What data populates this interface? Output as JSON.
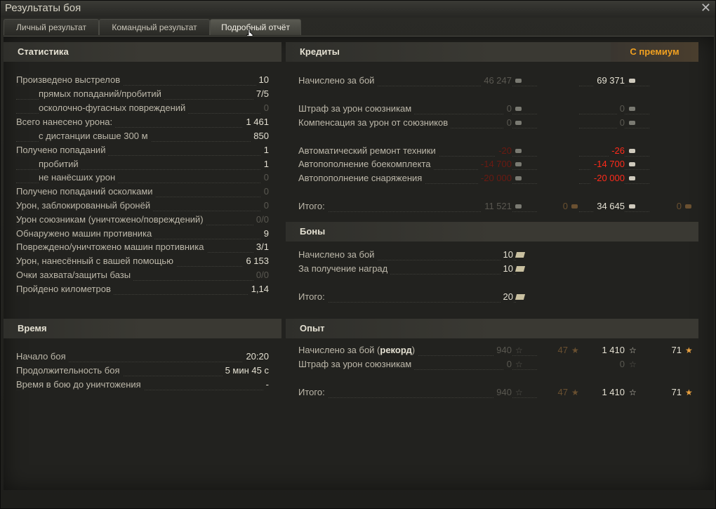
{
  "window": {
    "title": "Результаты боя"
  },
  "tabs": [
    {
      "label": "Личный результат"
    },
    {
      "label": "Командный результат"
    },
    {
      "label": "Подробный отчёт"
    }
  ],
  "statistics": {
    "header": "Статистика",
    "rows": [
      {
        "label": "Произведено выстрелов",
        "value": "10"
      },
      {
        "label": "прямых попаданий/пробитий",
        "value": "7/5"
      },
      {
        "label": "осколочно-фугасных повреждений",
        "value": "0"
      },
      {
        "label": "Всего нанесено урона:",
        "value": "1 461"
      },
      {
        "label": "с дистанции свыше 300 м",
        "value": "850"
      },
      {
        "label": "Получено попаданий",
        "value": "1"
      },
      {
        "label": "пробитий",
        "value": "1"
      },
      {
        "label": "не нанёсших урон",
        "value": "0"
      },
      {
        "label": "Получено попаданий осколками",
        "value": "0"
      },
      {
        "label": "Урон, заблокированный бронёй",
        "value": "0"
      },
      {
        "label": "Урон союзникам (уничтожено/повреждений)",
        "value": "0/0"
      },
      {
        "label": "Обнаружено машин противника",
        "value": "9"
      },
      {
        "label": "Повреждено/уничтожено машин противника",
        "value": "3/1"
      },
      {
        "label": "Урон, нанесённый с вашей помощью",
        "value": "6 153"
      },
      {
        "label": "Очки захвата/защиты базы",
        "value": "0/0"
      },
      {
        "label": "Пройдено километров",
        "value": "1,14"
      }
    ]
  },
  "time": {
    "header": "Время",
    "rows": [
      {
        "label": "Начало боя",
        "value": "20:20"
      },
      {
        "label": "Продолжительность боя",
        "value": "5 мин 45 с"
      },
      {
        "label": "Время в бою до уничтожения",
        "value": "-"
      }
    ]
  },
  "credits": {
    "header": "Кредиты",
    "premium_label": "С премиум",
    "rows": [
      {
        "label": "Начислено за бой",
        "base": "46 247",
        "prem": "69 371"
      },
      {
        "label": "Штраф за урон союзникам",
        "base": "0",
        "prem": "0"
      },
      {
        "label": "Компенсация за урон от союзников",
        "base": "0",
        "prem": "0"
      },
      {
        "label": "Автоматический ремонт техники",
        "base": "-20",
        "prem": "-26"
      },
      {
        "label": "Автопополнение боекомплекта",
        "base": "-14 700",
        "prem": "-14 700"
      },
      {
        "label": "Автопополнение снаряжения",
        "base": "-20 000",
        "prem": "-20 000"
      },
      {
        "label": "Итого:",
        "base": "11 521",
        "base_gold": "0",
        "prem": "34 645",
        "prem_gold": "0"
      }
    ]
  },
  "bonds": {
    "header": "Боны",
    "rows": [
      {
        "label": "Начислено за бой",
        "value": "10"
      },
      {
        "label": "За получение наград",
        "value": "10"
      },
      {
        "label": "Итого:",
        "value": "20"
      }
    ]
  },
  "experience": {
    "header": "Опыт",
    "rows": [
      {
        "label": "Начислено за бой (",
        "label_bold": "рекорд",
        "label_end": ")",
        "base": "940",
        "base_free": "47",
        "prem": "1 410",
        "prem_free": "71"
      },
      {
        "label": "Штраф за урон союзникам",
        "base": "0",
        "prem": "0"
      },
      {
        "label": "Итого:",
        "base": "940",
        "base_free": "47",
        "prem": "1 410",
        "prem_free": "71"
      }
    ]
  },
  "icons": {
    "close": "close-icon",
    "credit": "credit-icon",
    "gold": "gold-icon",
    "bond": "bond-icon",
    "xp": "xp-star-icon",
    "free_xp": "free-xp-star-icon"
  }
}
